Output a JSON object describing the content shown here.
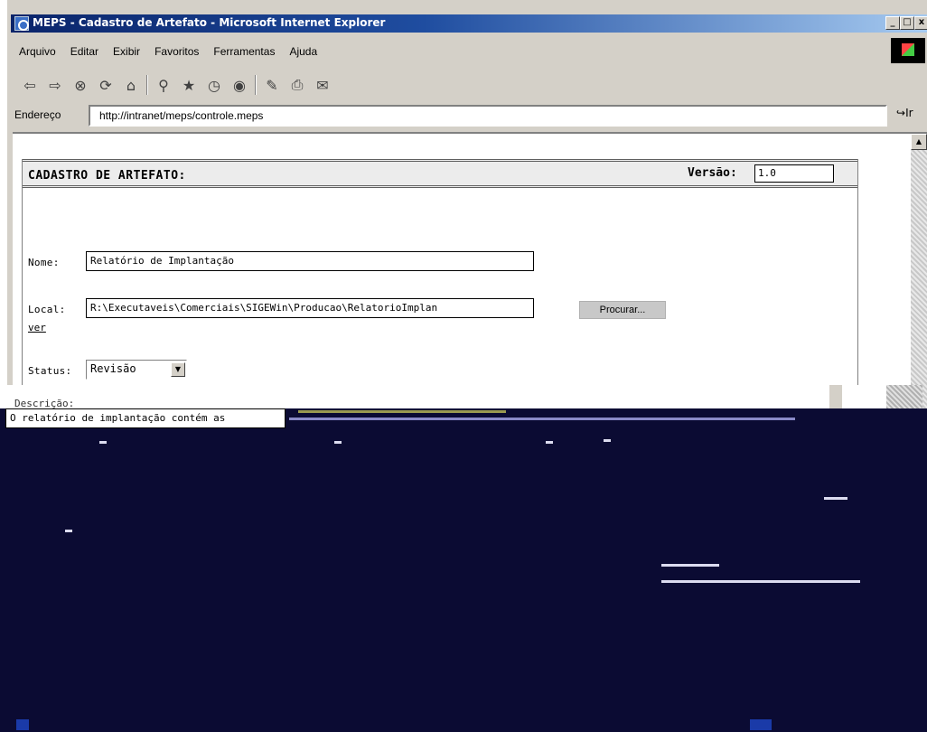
{
  "window": {
    "title": "MEPS - Cadastro de Artefato - Microsoft Internet Explorer",
    "controls": {
      "minimize": "_",
      "maximize": "□",
      "close": "x"
    }
  },
  "menu": {
    "items": [
      "Arquivo",
      "Editar",
      "Exibir",
      "Favoritos",
      "Ferramentas",
      "Ajuda"
    ]
  },
  "toolbar": {
    "icons": [
      "back-icon",
      "forward-icon",
      "stop-icon",
      "refresh-icon",
      "home-icon",
      "search-icon",
      "favorites-icon",
      "history-icon",
      "media-icon",
      "edit-icon",
      "print-icon",
      "mail-icon"
    ]
  },
  "address": {
    "label": "Endereço",
    "url": "http://intranet/meps/controle.meps",
    "go_label": "Ir"
  },
  "form": {
    "title": "CADASTRO DE ARTEFATO:",
    "version_label": "Versão:",
    "version_value": "1.0",
    "name_label": "Nome:",
    "name_value": "Relatório de Implantação",
    "local_label": "Local:",
    "local_value": "R:\\Executaveis\\Comerciais\\SIGEWin\\Producao\\RelatorioImplan",
    "browse_label": "Procurar...",
    "ver_link": "ver",
    "status_label": "Status:",
    "status_value": "Revisão",
    "description_label": "Descrição:",
    "description_value": "O relatório de implantação contém as"
  }
}
